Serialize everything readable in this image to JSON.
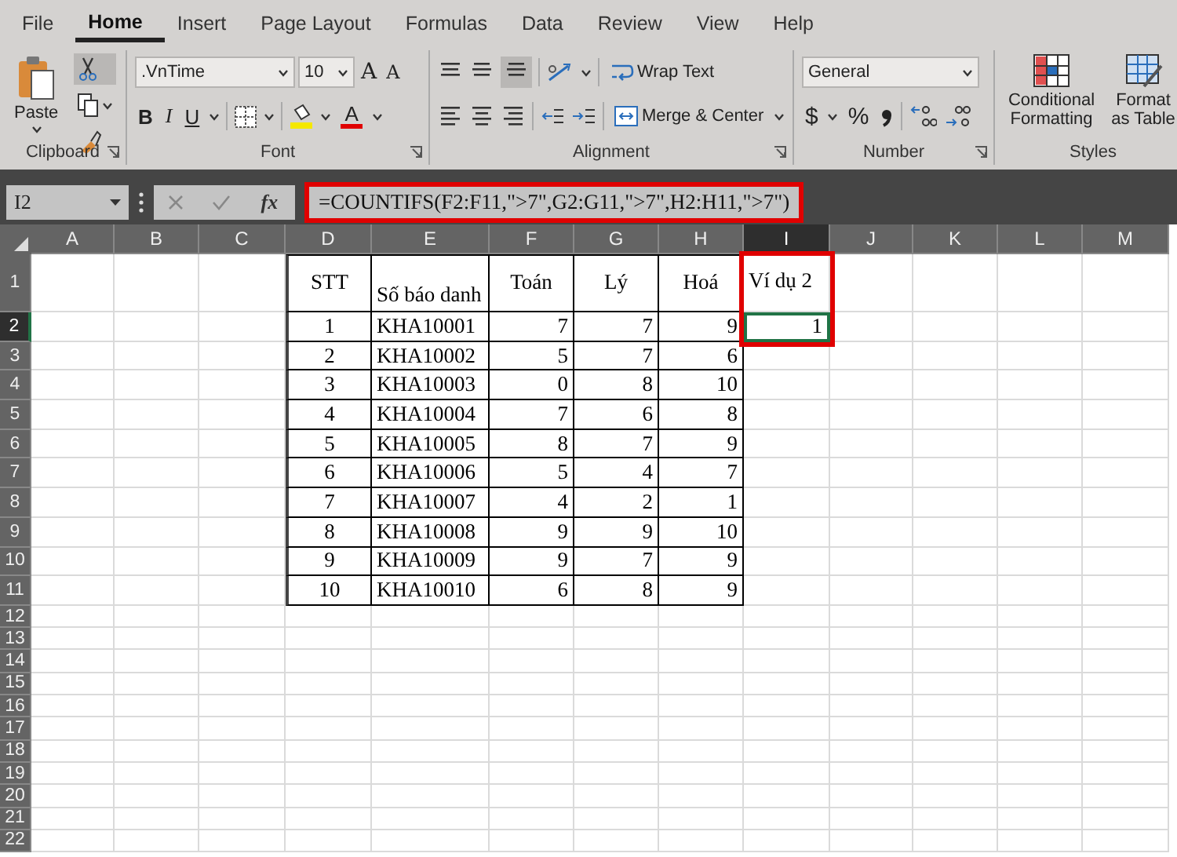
{
  "menu_tabs": [
    {
      "label": "File",
      "selected": false
    },
    {
      "label": "Home",
      "selected": true
    },
    {
      "label": "Insert",
      "selected": false
    },
    {
      "label": "Page Layout",
      "selected": false
    },
    {
      "label": "Formulas",
      "selected": false
    },
    {
      "label": "Data",
      "selected": false
    },
    {
      "label": "Review",
      "selected": false
    },
    {
      "label": "View",
      "selected": false
    },
    {
      "label": "Help",
      "selected": false
    }
  ],
  "ribbon": {
    "clipboard": {
      "title": "Clipboard",
      "paste": "Paste"
    },
    "font": {
      "title": "Font",
      "font_name": ".VnTime",
      "font_size": "10",
      "grow_font": "A",
      "shrink_font": "A",
      "bold": "B",
      "italic": "I",
      "underline": "U",
      "font_color": "A"
    },
    "alignment": {
      "title": "Alignment",
      "wrap_text": "Wrap Text",
      "merge": "Merge & Center"
    },
    "number": {
      "title": "Number",
      "format": "General",
      "currency": "$",
      "percent": "%"
    },
    "styles": {
      "title": "Styles",
      "conditional": "Conditional Formatting",
      "format_table": "Format as Table"
    }
  },
  "formula_bar": {
    "name_box": "I2",
    "fx": "fx",
    "formula": "=COUNTIFS(F2:F11,\">7\",G2:G11,\">7\",H2:H11,\">7\")",
    "highlighted": true
  },
  "sheet": {
    "columns": [
      {
        "label": "A",
        "selected": false
      },
      {
        "label": "B",
        "selected": false
      },
      {
        "label": "C",
        "selected": false
      },
      {
        "label": "D",
        "selected": false
      },
      {
        "label": "E",
        "selected": false
      },
      {
        "label": "F",
        "selected": false
      },
      {
        "label": "G",
        "selected": false
      },
      {
        "label": "H",
        "selected": false
      },
      {
        "label": "I",
        "selected": true
      },
      {
        "label": "J",
        "selected": false
      },
      {
        "label": "K",
        "selected": false
      },
      {
        "label": "L",
        "selected": false
      },
      {
        "label": "M",
        "selected": false
      }
    ],
    "rows": [
      {
        "label": "1",
        "selected": false
      },
      {
        "label": "2",
        "selected": true
      },
      {
        "label": "3",
        "selected": false
      },
      {
        "label": "4",
        "selected": false
      },
      {
        "label": "5",
        "selected": false
      },
      {
        "label": "6",
        "selected": false
      },
      {
        "label": "7",
        "selected": false
      },
      {
        "label": "8",
        "selected": false
      },
      {
        "label": "9",
        "selected": false
      },
      {
        "label": "10",
        "selected": false
      },
      {
        "label": "11",
        "selected": false
      },
      {
        "label": "12",
        "selected": false
      },
      {
        "label": "13",
        "selected": false
      },
      {
        "label": "14",
        "selected": false
      },
      {
        "label": "15",
        "selected": false
      },
      {
        "label": "16",
        "selected": false
      },
      {
        "label": "17",
        "selected": false
      },
      {
        "label": "18",
        "selected": false
      },
      {
        "label": "19",
        "selected": false
      },
      {
        "label": "20",
        "selected": false
      },
      {
        "label": "21",
        "selected": false
      },
      {
        "label": "22",
        "selected": false
      }
    ],
    "table": {
      "headers": [
        "STT",
        "Số báo danh",
        "Toán",
        "Lý",
        "Hoá"
      ],
      "rows": [
        [
          "1",
          "KHA10001",
          "7",
          "7",
          "9"
        ],
        [
          "2",
          "KHA10002",
          "5",
          "7",
          "6"
        ],
        [
          "3",
          "KHA10003",
          "0",
          "8",
          "10"
        ],
        [
          "4",
          "KHA10004",
          "7",
          "6",
          "8"
        ],
        [
          "5",
          "KHA10005",
          "8",
          "7",
          "9"
        ],
        [
          "6",
          "KHA10006",
          "5",
          "4",
          "7"
        ],
        [
          "7",
          "KHA10007",
          "4",
          "2",
          "1"
        ],
        [
          "8",
          "KHA10008",
          "9",
          "9",
          "10"
        ],
        [
          "9",
          "KHA10009",
          "9",
          "7",
          "9"
        ],
        [
          "10",
          "KHA10010",
          "6",
          "8",
          "9"
        ]
      ]
    },
    "result": {
      "header": "Ví dụ 2",
      "value": "1",
      "highlighted": true
    }
  }
}
